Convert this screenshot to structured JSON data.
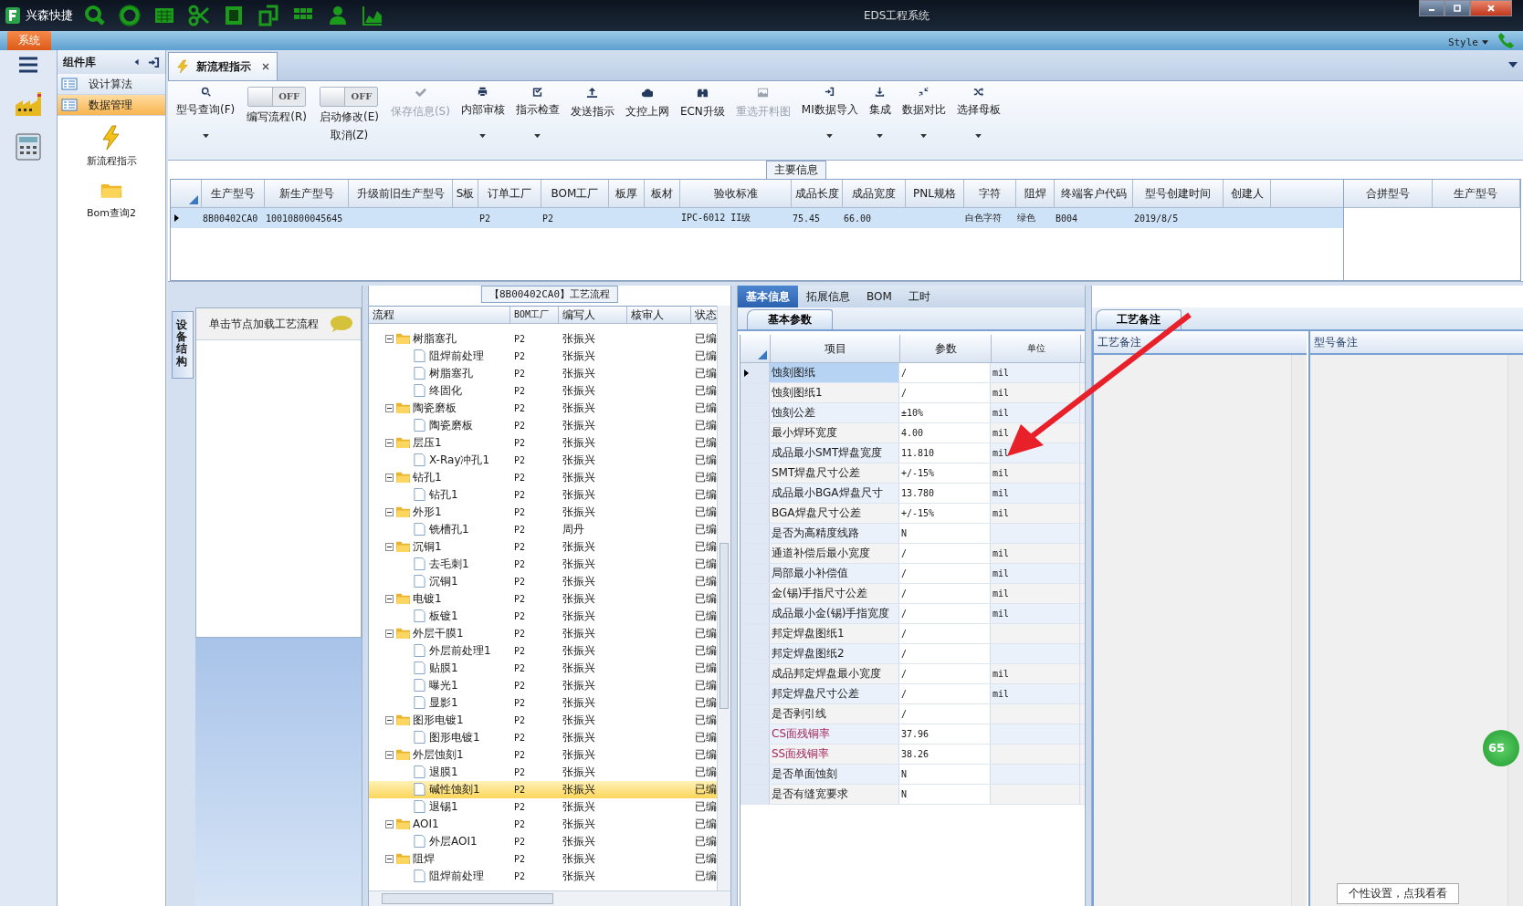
{
  "app": {
    "name": "兴森快捷",
    "title": "EDS工程系统"
  },
  "menu": {
    "system_tab": "系统",
    "style": "Style"
  },
  "sidebar": {
    "title": "组件库",
    "items": [
      {
        "label": "设计算法",
        "selected": false
      },
      {
        "label": "数据管理",
        "selected": true
      }
    ],
    "launchers": [
      "新流程指示",
      "Bom查询2"
    ]
  },
  "document_tab": {
    "label": "新流程指示"
  },
  "toolbar": [
    {
      "kind": "button",
      "label": "型号查询(F)",
      "disabled": false,
      "dropdown": true
    },
    {
      "kind": "toggle",
      "label": "编写流程(R)",
      "state_text": "OFF",
      "on": false
    },
    {
      "kind": "toggle",
      "label": "启动修改(E)",
      "sublabel": "取消(Z)",
      "state_text": "OFF",
      "on": false
    },
    {
      "kind": "button",
      "label": "保存信息(S)",
      "disabled": true,
      "dropdown": false
    },
    {
      "kind": "button",
      "label": "内部审核",
      "disabled": false,
      "dropdown": true
    },
    {
      "kind": "button",
      "label": "指示检查",
      "disabled": false,
      "dropdown": true
    },
    {
      "kind": "button",
      "label": "发送指示",
      "disabled": false,
      "dropdown": false
    },
    {
      "kind": "button",
      "label": "文控上网",
      "disabled": false,
      "dropdown": false
    },
    {
      "kind": "button",
      "label": "ECN升级",
      "disabled": false,
      "dropdown": false
    },
    {
      "kind": "button",
      "label": "重选开料图",
      "disabled": true,
      "dropdown": false
    },
    {
      "kind": "button",
      "label": "MI数据导入",
      "disabled": false,
      "dropdown": true
    },
    {
      "kind": "button",
      "label": "集成",
      "disabled": false,
      "dropdown": true
    },
    {
      "kind": "button",
      "label": "数据对比",
      "disabled": false,
      "dropdown": true
    },
    {
      "kind": "button",
      "label": "选择母板",
      "disabled": false,
      "dropdown": true
    }
  ],
  "main_info": {
    "title": "主要信息",
    "columns": [
      "生产型号",
      "新生产型号",
      "升级前旧生产型号",
      "S板",
      "订单工厂",
      "BOM工厂",
      "板厚",
      "板材",
      "验收标准",
      "成品长度",
      "成品宽度",
      "PNL规格",
      "字符",
      "阻焊",
      "终端客户代码",
      "型号创建时间",
      "创建人"
    ],
    "rows": [
      {
        "selected": true,
        "cells": [
          "8B00402CA0",
          "10010800045645",
          null,
          null,
          "P2",
          "P2",
          null,
          null,
          "IPC-6012 II级",
          "75.45",
          "66.00",
          null,
          "白色字符",
          "绿色",
          "B004",
          "2019/8/5",
          null
        ]
      }
    ],
    "side_columns": [
      "合拼型号",
      "生产型号"
    ]
  },
  "equipment_panel": {
    "tab": "设备结构",
    "hint": "单击节点加载工艺流程"
  },
  "flow": {
    "title": "【8B00402CA0】工艺流程",
    "columns": [
      "流程",
      "BOM工厂",
      "编写人",
      "核审人",
      "状态"
    ],
    "rows": [
      {
        "name": "树脂塞孔",
        "bom": "P2",
        "author": "张振兴",
        "status": "已编",
        "selected": false,
        "expanded": true,
        "children": [
          {
            "name": "阻焊前处理",
            "bom": "P2",
            "author": "张振兴",
            "status": "已编",
            "selected": false
          },
          {
            "name": "树脂塞孔",
            "bom": "P2",
            "author": "张振兴",
            "status": "已编",
            "selected": false
          },
          {
            "name": "终固化",
            "bom": "P2",
            "author": "张振兴",
            "status": "已编",
            "selected": false
          }
        ]
      },
      {
        "name": "陶瓷磨板",
        "bom": "P2",
        "author": "张振兴",
        "status": "已编",
        "selected": false,
        "expanded": true,
        "children": [
          {
            "name": "陶瓷磨板",
            "bom": "P2",
            "author": "张振兴",
            "status": "已编",
            "selected": false
          }
        ]
      },
      {
        "name": "层压1",
        "bom": "P2",
        "author": "张振兴",
        "status": "已编",
        "selected": false,
        "expanded": true,
        "children": [
          {
            "name": "X-Ray冲孔1",
            "bom": "P2",
            "author": "张振兴",
            "status": "已编",
            "selected": false
          }
        ]
      },
      {
        "name": "钻孔1",
        "bom": "P2",
        "author": "张振兴",
        "status": "已编",
        "selected": false,
        "expanded": true,
        "children": [
          {
            "name": "钻孔1",
            "bom": "P2",
            "author": "张振兴",
            "status": "已编",
            "selected": false
          }
        ]
      },
      {
        "name": "外形1",
        "bom": "P2",
        "author": "张振兴",
        "status": "已编",
        "selected": false,
        "expanded": true,
        "children": [
          {
            "name": "铣槽孔1",
            "bom": "P2",
            "author": "周丹",
            "status": "已编",
            "selected": false
          }
        ]
      },
      {
        "name": "沉铜1",
        "bom": "P2",
        "author": "张振兴",
        "status": "已编",
        "selected": false,
        "expanded": true,
        "children": [
          {
            "name": "去毛刺1",
            "bom": "P2",
            "author": "张振兴",
            "status": "已编",
            "selected": false
          },
          {
            "name": "沉铜1",
            "bom": "P2",
            "author": "张振兴",
            "status": "已编",
            "selected": false
          }
        ]
      },
      {
        "name": "电镀1",
        "bom": "P2",
        "author": "张振兴",
        "status": "已编",
        "selected": false,
        "expanded": true,
        "children": [
          {
            "name": "板镀1",
            "bom": "P2",
            "author": "张振兴",
            "status": "已编",
            "selected": false
          }
        ]
      },
      {
        "name": "外层干膜1",
        "bom": "P2",
        "author": "张振兴",
        "status": "已编",
        "selected": false,
        "expanded": true,
        "children": [
          {
            "name": "外层前处理1",
            "bom": "P2",
            "author": "张振兴",
            "status": "已编",
            "selected": false
          },
          {
            "name": "贴膜1",
            "bom": "P2",
            "author": "张振兴",
            "status": "已编",
            "selected": false
          },
          {
            "name": "曝光1",
            "bom": "P2",
            "author": "张振兴",
            "status": "已编",
            "selected": false
          },
          {
            "name": "显影1",
            "bom": "P2",
            "author": "张振兴",
            "status": "已编",
            "selected": false
          }
        ]
      },
      {
        "name": "图形电镀1",
        "bom": "P2",
        "author": "张振兴",
        "status": "已编",
        "selected": false,
        "expanded": true,
        "children": [
          {
            "name": "图形电镀1",
            "bom": "P2",
            "author": "张振兴",
            "status": "已编",
            "selected": false
          }
        ]
      },
      {
        "name": "外层蚀刻1",
        "bom": "P2",
        "author": "张振兴",
        "status": "已编",
        "selected": false,
        "expanded": true,
        "children": [
          {
            "name": "退膜1",
            "bom": "P2",
            "author": "张振兴",
            "status": "已编",
            "selected": false
          },
          {
            "name": "碱性蚀刻1",
            "bom": "P2",
            "author": "张振兴",
            "status": "已编",
            "selected": true
          },
          {
            "name": "退锡1",
            "bom": "P2",
            "author": "张振兴",
            "status": "已编",
            "selected": false
          }
        ]
      },
      {
        "name": "AOI1",
        "bom": "P2",
        "author": "张振兴",
        "status": "已编",
        "selected": false,
        "expanded": true,
        "children": [
          {
            "name": "外层AOI1",
            "bom": "P2",
            "author": "张振兴",
            "status": "已编",
            "selected": false
          }
        ]
      },
      {
        "name": "阻焊",
        "bom": "P2",
        "author": "张振兴",
        "status": "已编",
        "selected": false,
        "expanded": true,
        "children": [
          {
            "name": "阻焊前处理",
            "bom": "P2",
            "author": "张振兴",
            "status": "已编",
            "selected": false
          }
        ]
      }
    ]
  },
  "detail_tabs": [
    {
      "label": "基本信息",
      "selected": true
    },
    {
      "label": "拓展信息",
      "selected": false
    },
    {
      "label": "BOM",
      "selected": false
    },
    {
      "label": "工时",
      "selected": false
    }
  ],
  "params": {
    "tab": "基本参数",
    "columns": [
      "项目",
      "参数",
      "单位"
    ],
    "rows": [
      {
        "item": "蚀刻图纸",
        "value": "/",
        "unit": "mil",
        "selected": true,
        "flagged": false
      },
      {
        "item": "蚀刻图纸1",
        "value": "/",
        "unit": "mil",
        "selected": false,
        "flagged": false
      },
      {
        "item": "蚀刻公差",
        "value": "±10%",
        "unit": "mil",
        "selected": false,
        "flagged": false
      },
      {
        "item": "最小焊环宽度",
        "value": "4.00",
        "unit": "mil",
        "selected": false,
        "flagged": false
      },
      {
        "item": "成品最小SMT焊盘宽度",
        "value": "11.810",
        "unit": "mil",
        "selected": false,
        "flagged": false
      },
      {
        "item": "SMT焊盘尺寸公差",
        "value": "+/-15%",
        "unit": "mil",
        "selected": false,
        "flagged": false
      },
      {
        "item": "成品最小BGA焊盘尺寸",
        "value": "13.780",
        "unit": "mil",
        "selected": false,
        "flagged": false
      },
      {
        "item": "BGA焊盘尺寸公差",
        "value": "+/-15%",
        "unit": "mil",
        "selected": false,
        "flagged": false
      },
      {
        "item": "是否为高精度线路",
        "value": "N",
        "selected": false,
        "flagged": false
      },
      {
        "item": "通道补偿后最小宽度",
        "value": "/",
        "unit": "mil",
        "selected": false,
        "flagged": false
      },
      {
        "item": "局部最小补偿值",
        "value": "/",
        "unit": "mil",
        "selected": false,
        "flagged": false
      },
      {
        "item": "金(锡)手指尺寸公差",
        "value": "/",
        "unit": "mil",
        "selected": false,
        "flagged": false
      },
      {
        "item": "成品最小金(锡)手指宽度",
        "value": "/",
        "unit": "mil",
        "selected": false,
        "flagged": false
      },
      {
        "item": "邦定焊盘图纸1",
        "value": "/",
        "selected": false,
        "flagged": false
      },
      {
        "item": "邦定焊盘图纸2",
        "value": "/",
        "selected": false,
        "flagged": false
      },
      {
        "item": "成品邦定焊盘最小宽度",
        "value": "/",
        "unit": "mil",
        "selected": false,
        "flagged": false
      },
      {
        "item": "邦定焊盘尺寸公差",
        "value": "/",
        "unit": "mil",
        "selected": false,
        "flagged": false
      },
      {
        "item": "是否剥引线",
        "value": "/",
        "selected": false,
        "flagged": false
      },
      {
        "item": "CS面残铜率",
        "value": "37.96",
        "selected": false,
        "flagged": true
      },
      {
        "item": "SS面残铜率",
        "value": "38.26",
        "selected": false,
        "flagged": true
      },
      {
        "item": "是否单面蚀刻",
        "value": "N",
        "selected": false,
        "flagged": false
      },
      {
        "item": "是否有缝宽要求",
        "value": "N",
        "selected": false,
        "flagged": false
      }
    ]
  },
  "notes": {
    "tab": "工艺备注",
    "columns": [
      "工艺备注",
      "型号备注"
    ]
  },
  "floating": {
    "badge": "65",
    "tip": "个性设置，点我看看"
  }
}
